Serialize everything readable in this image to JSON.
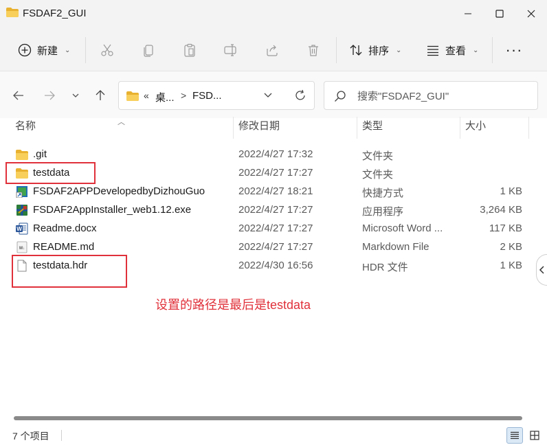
{
  "window": {
    "title": "FSDAF2_GUI"
  },
  "toolbar": {
    "new_label": "新建",
    "sort_label": "排序",
    "view_label": "查看",
    "more_label": "···"
  },
  "address": {
    "overflow": "«",
    "crumbs": [
      "桌...",
      "FSD..."
    ],
    "separator": ">"
  },
  "search": {
    "placeholder": "搜索\"FSDAF2_GUI\""
  },
  "columns": {
    "name": "名称",
    "date": "修改日期",
    "type": "类型",
    "size": "大小"
  },
  "files": [
    {
      "name": ".git",
      "date": "2022/4/27 17:32",
      "type": "文件夹",
      "size": "",
      "icon": "folder-icon"
    },
    {
      "name": "testdata",
      "date": "2022/4/27 17:27",
      "type": "文件夹",
      "size": "",
      "icon": "folder-icon"
    },
    {
      "name": "FSDAF2APPDevelopedbyDizhouGuo",
      "date": "2022/4/27 18:21",
      "type": "快捷方式",
      "size": "1 KB",
      "icon": "shortcut-icon"
    },
    {
      "name": "FSDAF2AppInstaller_web1.12.exe",
      "date": "2022/4/27 17:27",
      "type": "应用程序",
      "size": "3,264 KB",
      "icon": "installer-icon"
    },
    {
      "name": "Readme.docx",
      "date": "2022/4/27 17:27",
      "type": "Microsoft Word ...",
      "size": "117 KB",
      "icon": "word-doc-icon"
    },
    {
      "name": "README.md",
      "date": "2022/4/27 17:27",
      "type": "Markdown File",
      "size": "2 KB",
      "icon": "markdown-file-icon"
    },
    {
      "name": "testdata.hdr",
      "date": "2022/4/30 16:56",
      "type": "HDR 文件",
      "size": "1 KB",
      "icon": "blank-file-icon"
    }
  ],
  "annotation": {
    "text": "设置的路径是最后是testdata",
    "color": "#e0313a"
  },
  "status": {
    "item_count": "7 个项目"
  },
  "colors": {
    "accent": "#0067c0",
    "folder": "#f5c342",
    "annotation": "#e0313a"
  }
}
